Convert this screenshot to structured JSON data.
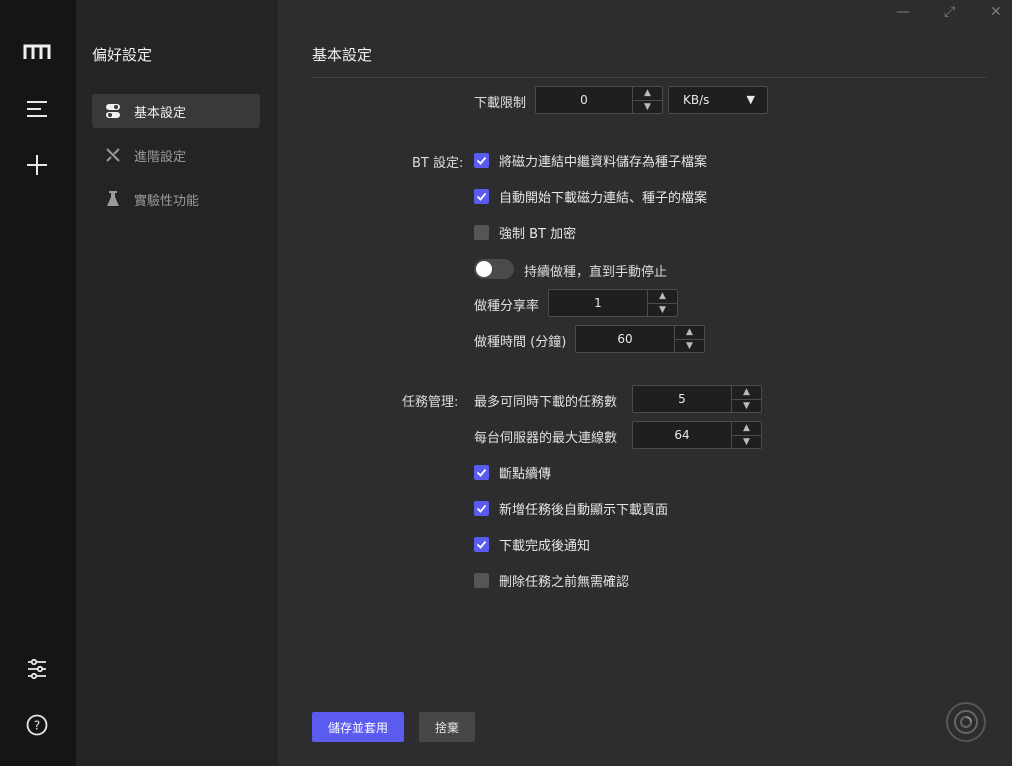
{
  "window": {
    "minimize": "—",
    "maximize": "⤢",
    "close": "✕"
  },
  "rail": {
    "items": [
      "menu-icon",
      "add-icon",
      "settings-sliders-icon",
      "help-icon"
    ],
    "help_glyph": "?"
  },
  "sidebar": {
    "title": "偏好設定",
    "items": [
      {
        "label": "基本設定",
        "icon": "toggle-icon",
        "active": true
      },
      {
        "label": "進階設定",
        "icon": "tools-icon",
        "active": false
      },
      {
        "label": "實驗性功能",
        "icon": "flask-icon",
        "active": false
      }
    ]
  },
  "main": {
    "title": "基本設定",
    "speed_limit": {
      "label": "下載限制",
      "value": "0",
      "unit": "KB/s"
    },
    "bt": {
      "section_label": "BT 設定:",
      "options": [
        {
          "label": "將磁力連結中繼資料儲存為種子檔案",
          "checked": true
        },
        {
          "label": "自動開始下載磁力連結、種子的檔案",
          "checked": true
        },
        {
          "label": "強制 BT 加密",
          "checked": false
        }
      ],
      "seeding_toggle": {
        "label": "持續做種，直到手動停止",
        "on": false
      },
      "ratio": {
        "label": "做種分享率",
        "value": "1"
      },
      "seed_time": {
        "label": "做種時間 (分鐘)",
        "value": "60"
      }
    },
    "tasks": {
      "section_label": "任務管理:",
      "max_concurrent": {
        "label": "最多可同時下載的任務數",
        "value": "5"
      },
      "max_connections": {
        "label": "每台伺服器的最大連線數",
        "value": "64"
      },
      "options": [
        {
          "label": "斷點續傳",
          "checked": true
        },
        {
          "label": "新增任務後自動顯示下載頁面",
          "checked": true
        },
        {
          "label": "下載完成後通知",
          "checked": true
        },
        {
          "label": "刪除任務之前無需確認",
          "checked": false
        }
      ]
    },
    "buttons": {
      "save": "儲存並套用",
      "discard": "捨棄"
    }
  },
  "colors": {
    "accent": "#5b5bf0",
    "rail_bg": "#151517",
    "sidebar_bg": "#242426",
    "main_bg": "#2d2d30"
  }
}
